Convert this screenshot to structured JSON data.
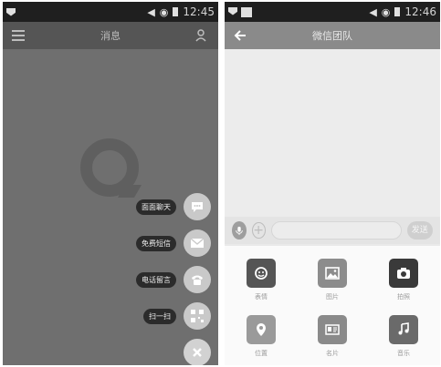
{
  "left_screen": {
    "status": {
      "time": "12:45"
    },
    "topbar": {
      "title": "消息"
    },
    "fab_menu": [
      {
        "label": "面面聊天",
        "icon": "chat-bubble-icon"
      },
      {
        "label": "免费短信",
        "icon": "envelope-icon"
      },
      {
        "label": "电话留言",
        "icon": "telephone-icon"
      },
      {
        "label": "扫一扫",
        "icon": "qr-code-icon"
      }
    ],
    "close_icon": "close-icon"
  },
  "right_screen": {
    "status": {
      "time": "12:46"
    },
    "topbar": {
      "title": "微信团队"
    },
    "input": {
      "placeholder": "",
      "send_label": "发送"
    },
    "attachments": [
      {
        "label": "表情",
        "icon": "smiley-icon",
        "color": "#555555"
      },
      {
        "label": "图片",
        "icon": "image-icon",
        "color": "#8c8c8c"
      },
      {
        "label": "拍照",
        "icon": "camera-icon",
        "color": "#3a3a3a"
      },
      {
        "label": "位置",
        "icon": "location-pin-icon",
        "color": "#9a9a9a"
      },
      {
        "label": "名片",
        "icon": "contact-card-icon",
        "color": "#8a8a8a"
      },
      {
        "label": "音乐",
        "icon": "music-note-icon",
        "color": "#6a6a6a"
      }
    ]
  }
}
